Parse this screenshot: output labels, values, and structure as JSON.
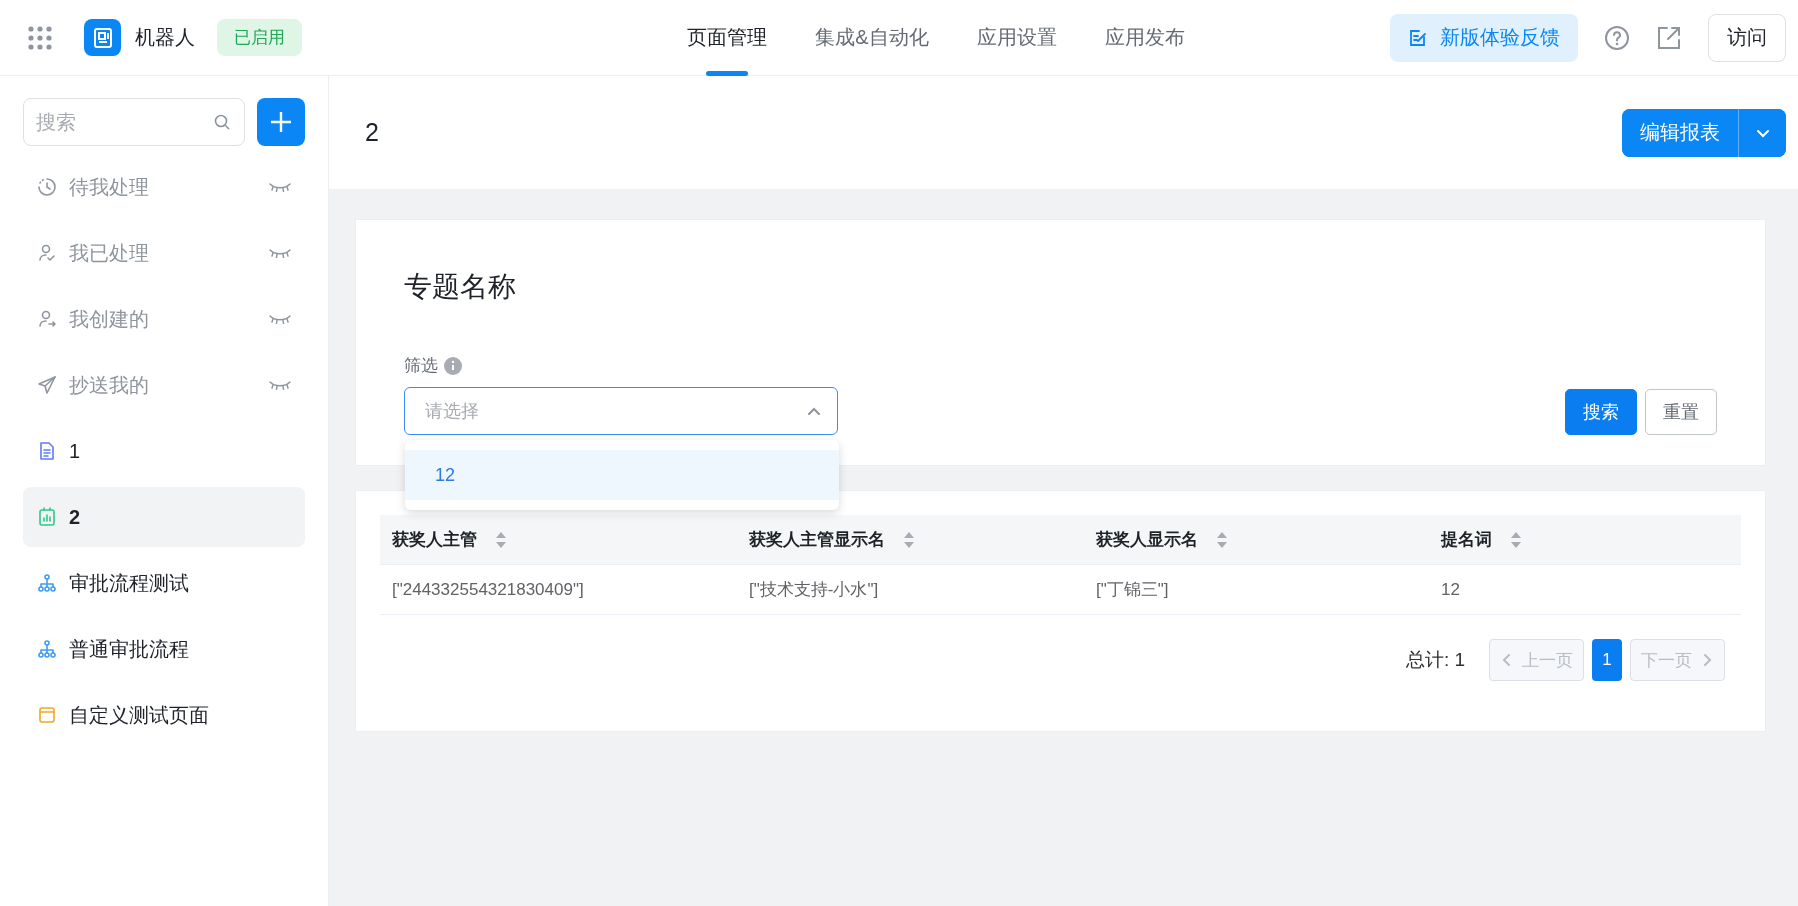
{
  "app": {
    "name": "机器人",
    "status": "已启用"
  },
  "tabs": [
    {
      "label": "页面管理",
      "selected": true
    },
    {
      "label": "集成&自动化",
      "selected": false
    },
    {
      "label": "应用设置",
      "selected": false
    },
    {
      "label": "应用发布",
      "selected": false
    }
  ],
  "header_actions": {
    "feedback": "新版体验反馈",
    "visit": "访问"
  },
  "sidebar": {
    "search": {
      "placeholder": "搜索"
    },
    "items": [
      {
        "label": "待我处理",
        "kind": "pending",
        "hidden": true,
        "selected": false
      },
      {
        "label": "我已处理",
        "kind": "done",
        "hidden": true,
        "selected": false
      },
      {
        "label": "我创建的",
        "kind": "created",
        "hidden": true,
        "selected": false
      },
      {
        "label": "抄送我的",
        "kind": "cc",
        "hidden": true,
        "selected": false
      },
      {
        "label": "1",
        "kind": "form",
        "hidden": false,
        "selected": false
      },
      {
        "label": "2",
        "kind": "report",
        "hidden": false,
        "selected": true
      },
      {
        "label": "审批流程测试",
        "kind": "flow",
        "hidden": false,
        "selected": false
      },
      {
        "label": "普通审批流程",
        "kind": "flow",
        "hidden": false,
        "selected": false
      },
      {
        "label": "自定义测试页面",
        "kind": "custom",
        "hidden": false,
        "selected": false
      }
    ]
  },
  "page": {
    "title": "2",
    "edit_button": "编辑报表"
  },
  "filter": {
    "title": "专题名称",
    "label": "筛选",
    "select": {
      "placeholder": "请选择",
      "expanded": true,
      "options": [
        "12"
      ]
    },
    "search_button": "搜索",
    "reset_button": "重置"
  },
  "table": {
    "columns": [
      "获奖人主管",
      "获奖人主管显示名",
      "获奖人显示名",
      "提名词"
    ],
    "rows": [
      [
        "[\"244332554321830409\"]",
        "[\"技术支持-小水\"]",
        "[\"丁锦三\"]",
        "12"
      ]
    ]
  },
  "pagination": {
    "total": "总计: 1",
    "prev": {
      "label": "上一页",
      "disabled": true
    },
    "pages": [
      {
        "label": "1",
        "selected": true
      }
    ],
    "next": {
      "label": "下一页",
      "disabled": true
    }
  }
}
